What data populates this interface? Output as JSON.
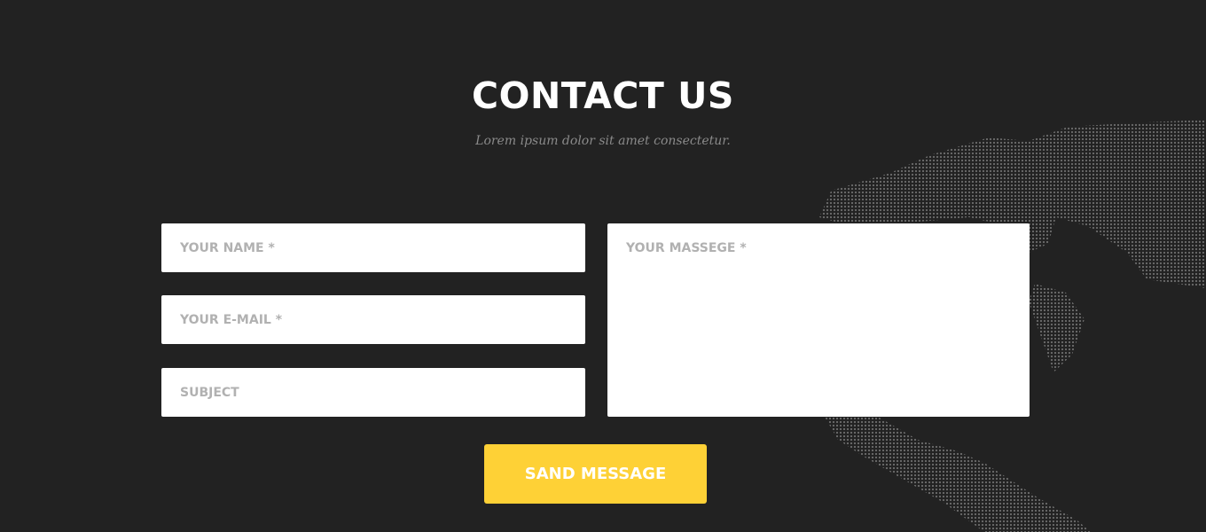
{
  "section": {
    "title": "CONTACT US",
    "subtitle": "Lorem ipsum dolor sit amet consectetur."
  },
  "form": {
    "name_placeholder": "YOUR NAME *",
    "email_placeholder": "YOUR E-MAIL *",
    "subject_placeholder": "SUBJECT",
    "message_placeholder": "YOUR MASSEGE *",
    "submit_label": "SAND MESSAGE"
  },
  "colors": {
    "background": "#222222",
    "accent": "#fed136"
  },
  "background_image": "dotted-world-map"
}
